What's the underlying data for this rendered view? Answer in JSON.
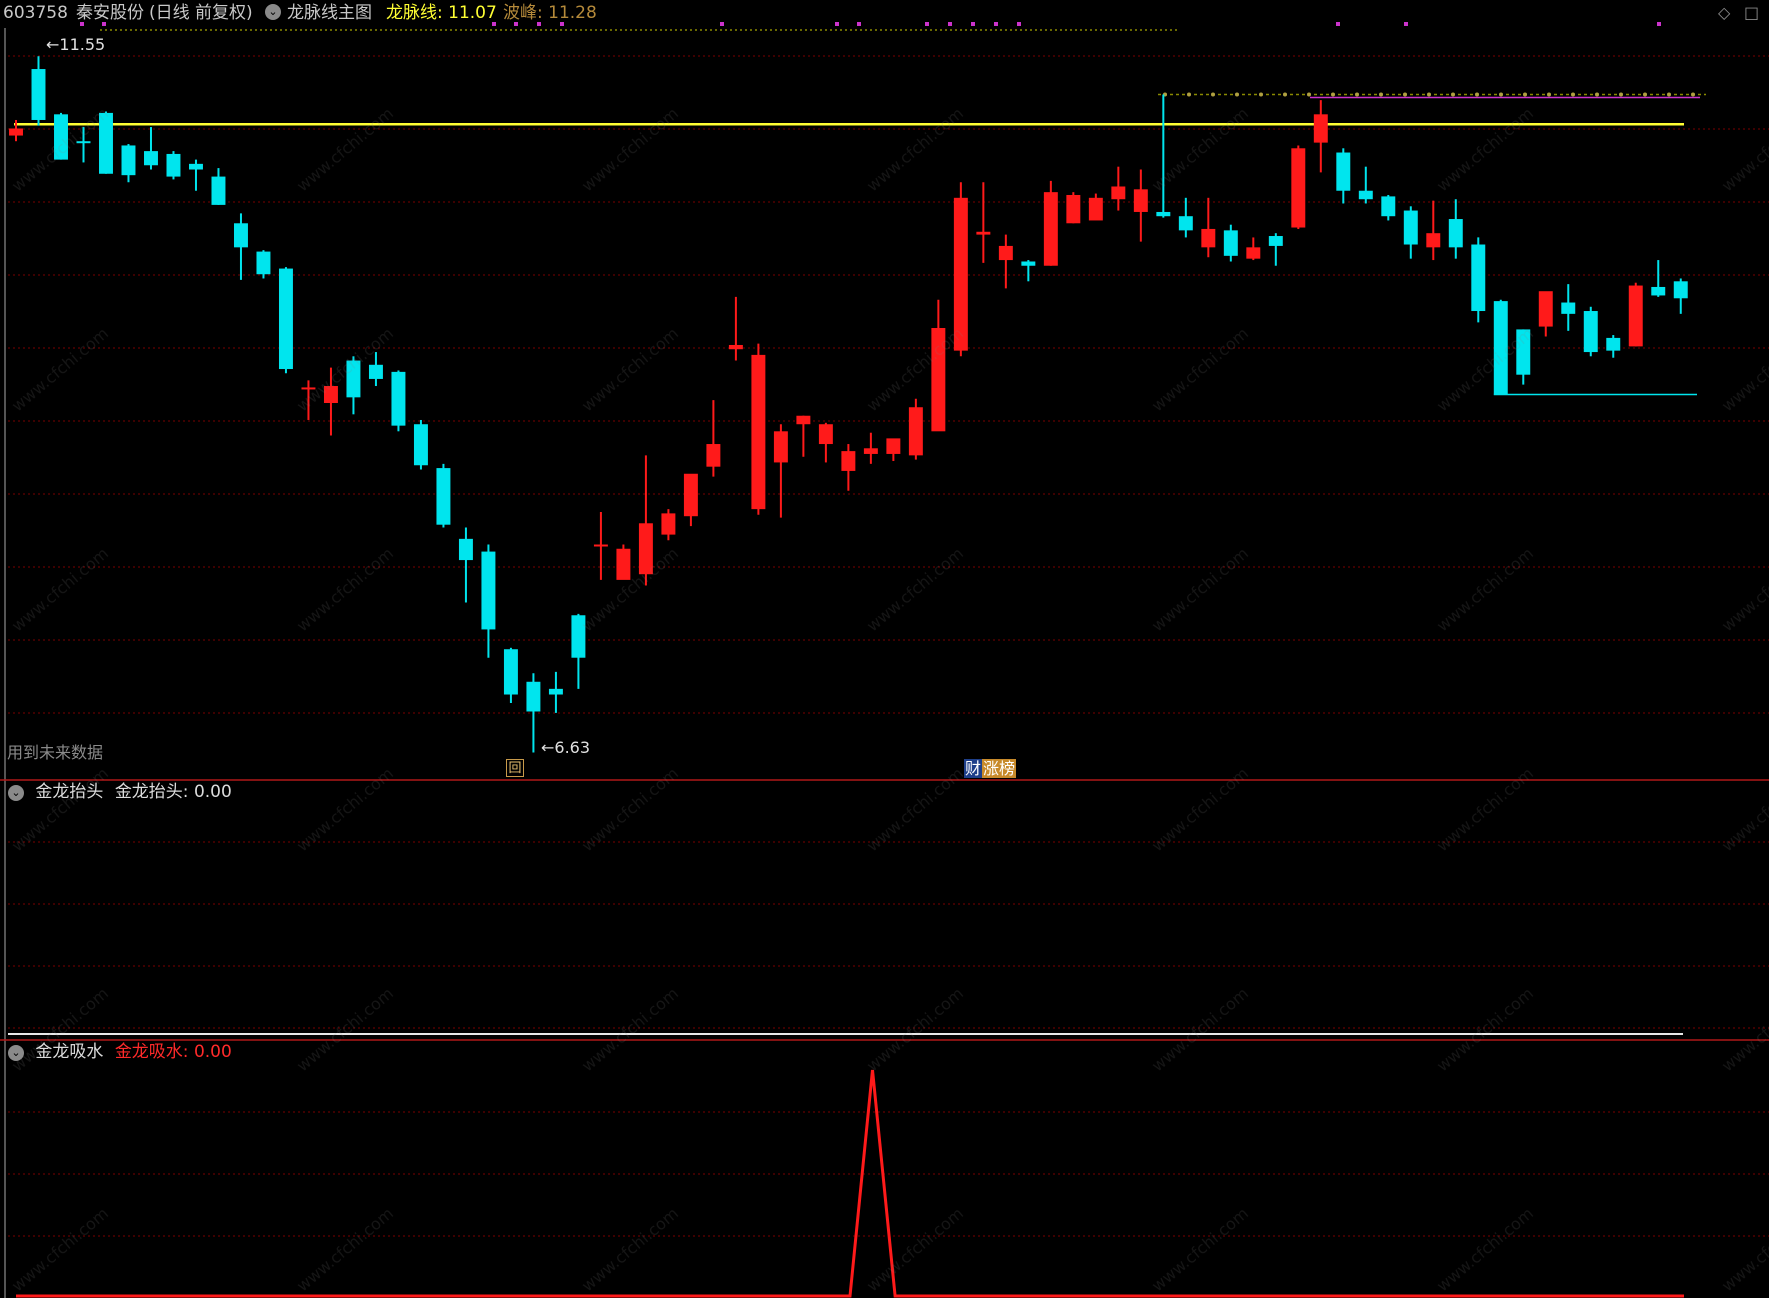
{
  "header": {
    "stock_code": "603758",
    "stock_name": "秦安股份",
    "period_mode": "(日线 前复权)",
    "main_indicator": "龙脉线主图",
    "dragon_line_label": "龙脉线: 11.07",
    "peak_label": "波峰: 11.28"
  },
  "main_panel": {
    "high_marker": "11.55",
    "low_marker": "6.63",
    "future_data_note": "用到未来数据",
    "bottom_icon_label": "回",
    "badge_left": "财",
    "badge_right": "涨榜"
  },
  "panel2": {
    "name": "金龙抬头",
    "value_label": "金龙抬头: 0.00"
  },
  "panel3": {
    "name": "金龙吸水",
    "value_label": "金龙吸水: 0.00"
  },
  "watermark": "www.cfchi.com",
  "colors": {
    "up": "#ff1a1a",
    "down": "#00e5ee",
    "dragon_line": "#ffff33",
    "grid": "#7a0000",
    "separator": "#b01818",
    "dots": "#cc33cc",
    "tick_line": "#8a8a00"
  },
  "chart_data": [
    {
      "type": "candlestick",
      "title": "603758 秦安股份(日线 前复权) 龙脉线主图",
      "ylim": [
        6.45,
        11.75
      ],
      "dragon_line": 11.07,
      "peak": 11.28,
      "candles": [
        {
          "o": 10.99,
          "h": 11.1,
          "l": 10.95,
          "c": 11.04
        },
        {
          "o": 11.46,
          "h": 11.55,
          "l": 11.06,
          "c": 11.1
        },
        {
          "o": 11.14,
          "h": 11.15,
          "l": 10.82,
          "c": 10.82
        },
        {
          "o": 10.95,
          "h": 11.05,
          "l": 10.8,
          "c": 10.94
        },
        {
          "o": 11.15,
          "h": 11.16,
          "l": 10.72,
          "c": 10.72
        },
        {
          "o": 10.92,
          "h": 10.93,
          "l": 10.66,
          "c": 10.71
        },
        {
          "o": 10.88,
          "h": 11.05,
          "l": 10.75,
          "c": 10.78
        },
        {
          "o": 10.86,
          "h": 10.88,
          "l": 10.68,
          "c": 10.7
        },
        {
          "o": 10.79,
          "h": 10.82,
          "l": 10.6,
          "c": 10.75
        },
        {
          "o": 10.7,
          "h": 10.76,
          "l": 10.5,
          "c": 10.5
        },
        {
          "o": 10.37,
          "h": 10.44,
          "l": 9.97,
          "c": 10.2
        },
        {
          "o": 10.17,
          "h": 10.18,
          "l": 9.98,
          "c": 10.01
        },
        {
          "o": 10.05,
          "h": 10.06,
          "l": 9.31,
          "c": 9.34
        },
        {
          "o": 9.2,
          "h": 9.26,
          "l": 8.98,
          "c": 9.21
        },
        {
          "o": 9.1,
          "h": 9.35,
          "l": 8.87,
          "c": 9.22
        },
        {
          "o": 9.4,
          "h": 9.43,
          "l": 9.02,
          "c": 9.14
        },
        {
          "o": 9.37,
          "h": 9.46,
          "l": 9.22,
          "c": 9.27
        },
        {
          "o": 9.32,
          "h": 9.33,
          "l": 8.9,
          "c": 8.94
        },
        {
          "o": 8.95,
          "h": 8.98,
          "l": 8.63,
          "c": 8.66
        },
        {
          "o": 8.64,
          "h": 8.67,
          "l": 8.22,
          "c": 8.24
        },
        {
          "o": 8.14,
          "h": 8.22,
          "l": 7.69,
          "c": 7.99
        },
        {
          "o": 8.05,
          "h": 8.1,
          "l": 7.3,
          "c": 7.5
        },
        {
          "o": 7.36,
          "h": 7.37,
          "l": 6.98,
          "c": 7.04
        },
        {
          "o": 7.13,
          "h": 7.19,
          "l": 6.63,
          "c": 6.92
        },
        {
          "o": 7.08,
          "h": 7.2,
          "l": 6.91,
          "c": 7.04
        },
        {
          "o": 7.6,
          "h": 7.61,
          "l": 7.08,
          "c": 7.3
        },
        {
          "o": 8.1,
          "h": 8.33,
          "l": 7.85,
          "c": 8.1
        },
        {
          "o": 7.85,
          "h": 8.1,
          "l": 7.89,
          "c": 8.07
        },
        {
          "o": 7.89,
          "h": 8.73,
          "l": 7.81,
          "c": 8.25
        },
        {
          "o": 8.17,
          "h": 8.35,
          "l": 8.13,
          "c": 8.32
        },
        {
          "o": 8.3,
          "h": 8.56,
          "l": 8.23,
          "c": 8.6
        },
        {
          "o": 8.65,
          "h": 9.12,
          "l": 8.58,
          "c": 8.81
        },
        {
          "o": 9.48,
          "h": 9.85,
          "l": 9.4,
          "c": 9.51
        },
        {
          "o": 8.35,
          "h": 9.52,
          "l": 8.31,
          "c": 9.44
        },
        {
          "o": 8.68,
          "h": 8.95,
          "l": 8.29,
          "c": 8.9
        },
        {
          "o": 8.95,
          "h": 9.01,
          "l": 8.72,
          "c": 9.01
        },
        {
          "o": 8.81,
          "h": 8.96,
          "l": 8.68,
          "c": 8.95
        },
        {
          "o": 8.62,
          "h": 8.81,
          "l": 8.48,
          "c": 8.76
        },
        {
          "o": 8.74,
          "h": 8.89,
          "l": 8.67,
          "c": 8.78
        },
        {
          "o": 8.74,
          "h": 8.84,
          "l": 8.69,
          "c": 8.85
        },
        {
          "o": 8.73,
          "h": 9.13,
          "l": 8.7,
          "c": 9.07
        },
        {
          "o": 8.9,
          "h": 9.83,
          "l": 8.92,
          "c": 9.63
        },
        {
          "o": 9.47,
          "h": 10.66,
          "l": 9.43,
          "c": 10.55
        },
        {
          "o": 10.29,
          "h": 10.66,
          "l": 10.09,
          "c": 10.31
        },
        {
          "o": 10.11,
          "h": 10.29,
          "l": 9.91,
          "c": 10.21
        },
        {
          "o": 10.1,
          "h": 10.11,
          "l": 9.96,
          "c": 10.07
        },
        {
          "o": 10.07,
          "h": 10.67,
          "l": 10.07,
          "c": 10.59
        },
        {
          "o": 10.37,
          "h": 10.59,
          "l": 10.37,
          "c": 10.57
        },
        {
          "o": 10.39,
          "h": 10.58,
          "l": 10.44,
          "c": 10.55
        },
        {
          "o": 10.54,
          "h": 10.77,
          "l": 10.46,
          "c": 10.63
        },
        {
          "o": 10.45,
          "h": 10.75,
          "l": 10.24,
          "c": 10.61
        },
        {
          "o": 10.45,
          "h": 11.28,
          "l": 10.41,
          "c": 10.42
        },
        {
          "o": 10.42,
          "h": 10.55,
          "l": 10.27,
          "c": 10.32
        },
        {
          "o": 10.2,
          "h": 10.55,
          "l": 10.13,
          "c": 10.33
        },
        {
          "o": 10.32,
          "h": 10.36,
          "l": 10.1,
          "c": 10.14
        },
        {
          "o": 10.12,
          "h": 10.27,
          "l": 10.11,
          "c": 10.2
        },
        {
          "o": 10.28,
          "h": 10.3,
          "l": 10.07,
          "c": 10.21
        },
        {
          "o": 10.34,
          "h": 10.92,
          "l": 10.33,
          "c": 10.9
        },
        {
          "o": 10.94,
          "h": 11.24,
          "l": 10.73,
          "c": 11.14
        },
        {
          "o": 10.87,
          "h": 10.9,
          "l": 10.51,
          "c": 10.6
        },
        {
          "o": 10.6,
          "h": 10.77,
          "l": 10.51,
          "c": 10.54
        },
        {
          "o": 10.56,
          "h": 10.57,
          "l": 10.39,
          "c": 10.42
        },
        {
          "o": 10.46,
          "h": 10.49,
          "l": 10.12,
          "c": 10.22
        },
        {
          "o": 10.2,
          "h": 10.53,
          "l": 10.11,
          "c": 10.3
        },
        {
          "o": 10.4,
          "h": 10.54,
          "l": 10.12,
          "c": 10.2
        },
        {
          "o": 10.22,
          "h": 10.27,
          "l": 9.67,
          "c": 9.75
        },
        {
          "o": 9.82,
          "h": 9.83,
          "l": 9.16,
          "c": 9.16
        },
        {
          "o": 9.62,
          "h": 9.62,
          "l": 9.23,
          "c": 9.3
        },
        {
          "o": 9.64,
          "h": 9.86,
          "l": 9.57,
          "c": 9.89
        },
        {
          "o": 9.81,
          "h": 9.94,
          "l": 9.61,
          "c": 9.73
        },
        {
          "o": 9.75,
          "h": 9.78,
          "l": 9.43,
          "c": 9.46
        },
        {
          "o": 9.56,
          "h": 9.58,
          "l": 9.42,
          "c": 9.47
        },
        {
          "o": 9.5,
          "h": 9.95,
          "l": 9.5,
          "c": 9.93
        },
        {
          "o": 9.92,
          "h": 10.11,
          "l": 9.85,
          "c": 9.86
        },
        {
          "o": 9.96,
          "h": 9.98,
          "l": 9.73,
          "c": 9.84
        }
      ],
      "support_line": 9.16
    },
    {
      "type": "line",
      "title": "金龙抬头",
      "series": [
        {
          "name": "金龙抬头",
          "values": [
            0
          ]
        }
      ]
    },
    {
      "type": "line",
      "title": "金龙吸水",
      "x_count": 75,
      "series": [
        {
          "name": "金龙吸水",
          "values": [
            0,
            0,
            0,
            0,
            0,
            0,
            0,
            0,
            0,
            0,
            0,
            0,
            0,
            0,
            0,
            0,
            0,
            0,
            0,
            0,
            0,
            0,
            0,
            0,
            0,
            0,
            0,
            0,
            0,
            0,
            0,
            0,
            0,
            0,
            0,
            0,
            0,
            0,
            1,
            0,
            0,
            0,
            0,
            0,
            0,
            0,
            0,
            0,
            0,
            0,
            0,
            0,
            0,
            0,
            0,
            0,
            0,
            0,
            0,
            0,
            0,
            0,
            0,
            0,
            0,
            0,
            0,
            0,
            0,
            0,
            0,
            0,
            0,
            0,
            0
          ]
        }
      ]
    }
  ]
}
